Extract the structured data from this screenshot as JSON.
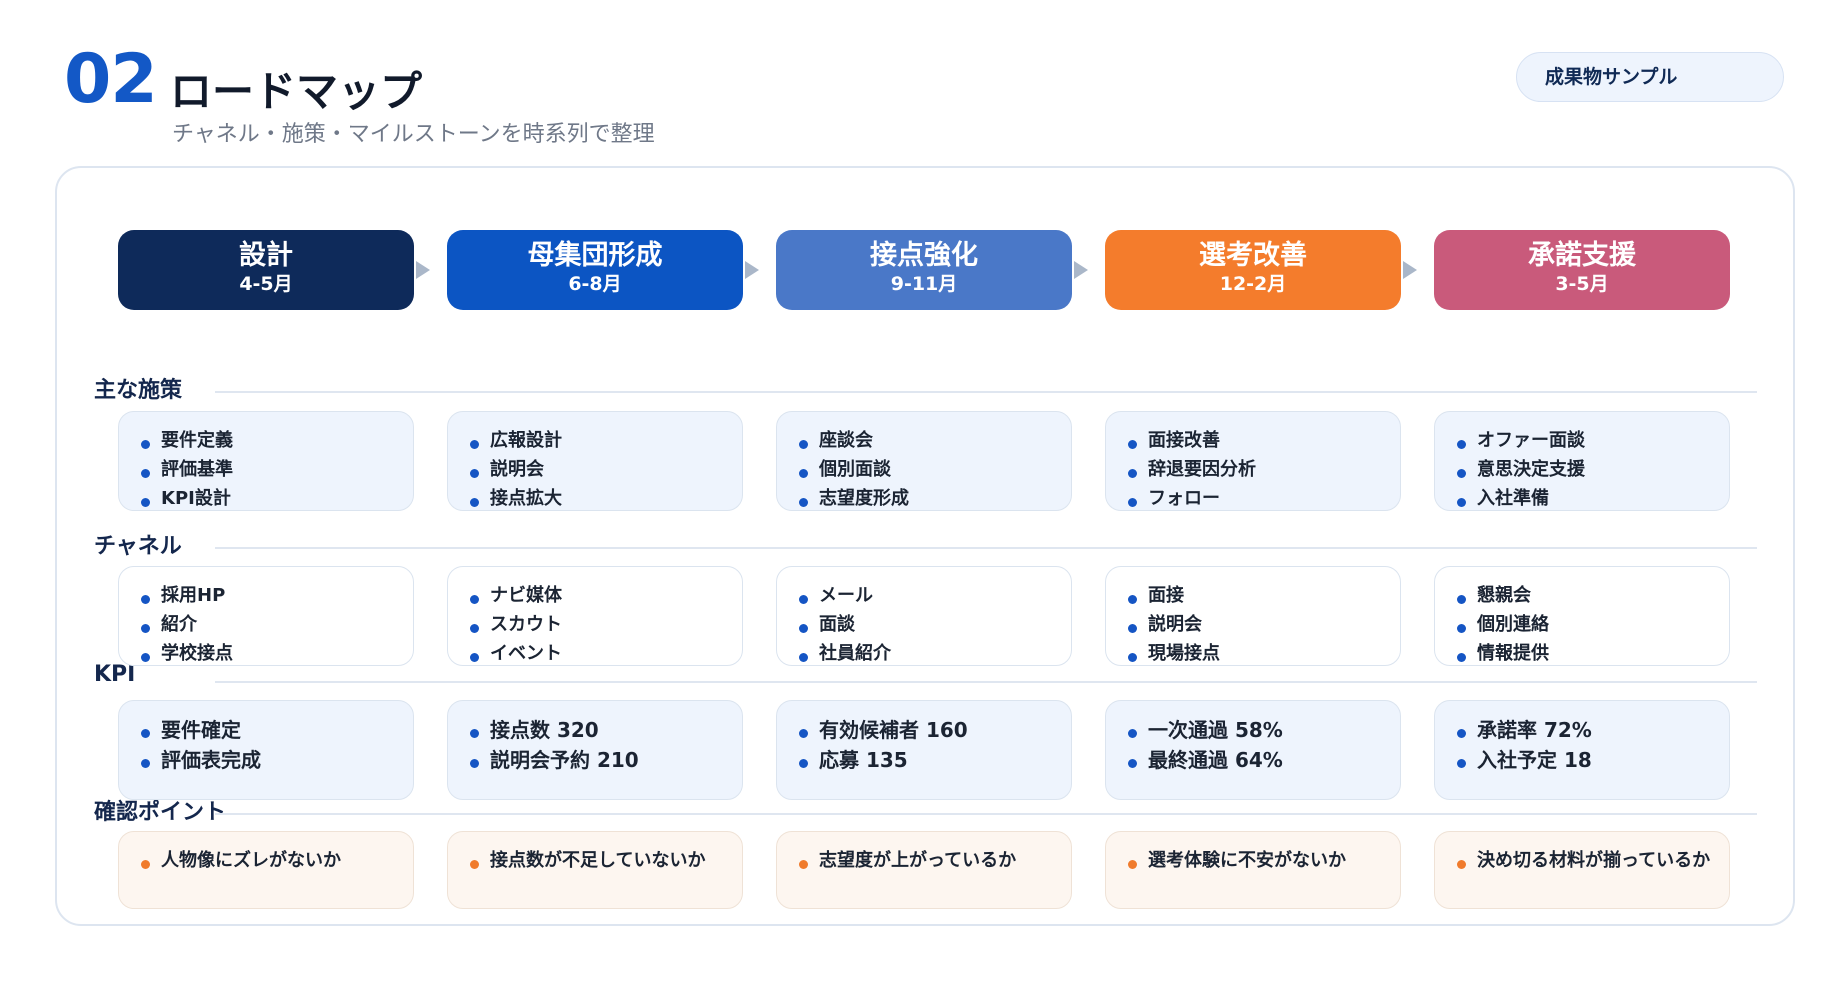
{
  "header": {
    "number": "02",
    "title": "ロードマップ",
    "subtitle": "チャネル・施策・マイルストーンを時系列で整理",
    "badge": "成果物サンプル"
  },
  "colors": {
    "accent": "#1358c6",
    "phase_design": "#0e2a5a",
    "phase_pool": "#0c55c3",
    "phase_contact": "#4a78c8",
    "phase_selection": "#f47c2c",
    "phase_acceptance": "#c95a7b",
    "bullet_blue": "#1555c4",
    "bullet_orange": "#f07b2c"
  },
  "phases": [
    {
      "name": "設計",
      "period": "4-5月"
    },
    {
      "name": "母集団形成",
      "period": "6-8月"
    },
    {
      "name": "接点強化",
      "period": "9-11月"
    },
    {
      "name": "選考改善",
      "period": "12-2月"
    },
    {
      "name": "承諾支援",
      "period": "3-5月"
    }
  ],
  "sections": {
    "measures": {
      "title": "主な施策",
      "cards": [
        [
          "要件定義",
          "評価基準",
          "KPI設計"
        ],
        [
          "広報設計",
          "説明会",
          "接点拡大"
        ],
        [
          "座談会",
          "個別面談",
          "志望度形成"
        ],
        [
          "面接改善",
          "辞退要因分析",
          "フォロー"
        ],
        [
          "オファー面談",
          "意思決定支援",
          "入社準備"
        ]
      ]
    },
    "channels": {
      "title": "チャネル",
      "cards": [
        [
          "採用HP",
          "紹介",
          "学校接点"
        ],
        [
          "ナビ媒体",
          "スカウト",
          "イベント"
        ],
        [
          "メール",
          "面談",
          "社員紹介"
        ],
        [
          "面接",
          "説明会",
          "現場接点"
        ],
        [
          "懇親会",
          "個別連絡",
          "情報提供"
        ]
      ]
    },
    "kpi": {
      "title": "KPI",
      "cards": [
        [
          "要件確定",
          "評価表完成"
        ],
        [
          "接点数 320",
          "説明会予約 210"
        ],
        [
          "有効候補者 160",
          "応募 135"
        ],
        [
          "一次通過 58%",
          "最終通過 64%"
        ],
        [
          "承諾率 72%",
          "入社予定 18"
        ]
      ]
    },
    "checkpoints": {
      "title": "確認ポイント",
      "cards": [
        [
          "人物像にズレがないか"
        ],
        [
          "接点数が不足していないか"
        ],
        [
          "志望度が上がっているか"
        ],
        [
          "選考体験に不安がないか"
        ],
        [
          "決め切る材料が揃っているか"
        ]
      ]
    }
  }
}
